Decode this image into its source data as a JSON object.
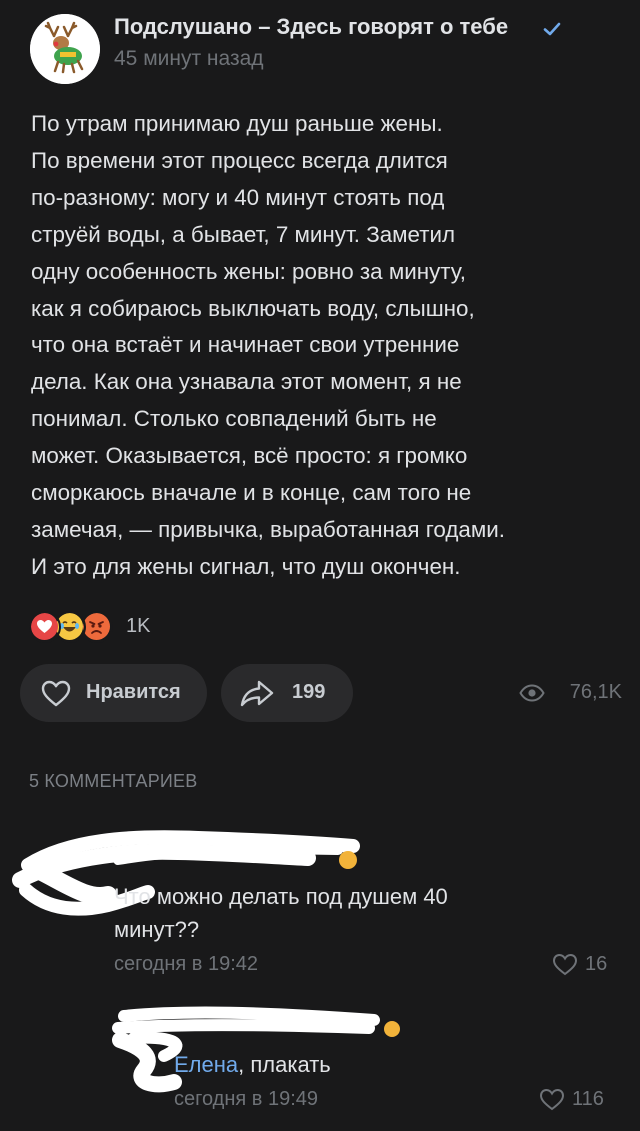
{
  "post": {
    "group_name": "Подслушано – Здесь говорят о тебе",
    "time": "45 минут назад",
    "text_lines": [
      "По утрам принимаю душ раньше жены.",
      "По времени этот процесс всегда длится",
      "по-разному: могу и 40 минут стоять под",
      "струёй воды, а бывает, 7 минут. Заметил",
      "одну особенность жены: ровно за минуту,",
      "как я собираюсь выключать воду, слышно,",
      "что она встаёт и начинает свои утренние",
      "дела. Как она узнавала этот момент, я не",
      "понимал. Столько совпадений быть не",
      "может. Оказывается, всё просто: я громко",
      "сморкаюсь вначале и в конце, сам того не",
      "замечая, — привычка, выработанная годами.",
      "И это для жены сигнал, что душ окончен."
    ],
    "reactions": [
      "heart-reaction",
      "laughing-reaction",
      "angry-reaction"
    ],
    "reactions_count": "1K",
    "like_label": "Нравится",
    "shares_count": "199",
    "views_count": "76,1K"
  },
  "comments_header": "5 КОММЕНТАРИЕВ",
  "comments": [
    {
      "text_lines": [
        "Что можно делать под душем 40",
        "минут??"
      ],
      "time": "сегодня в 19:42",
      "likes": "16"
    },
    {
      "reply_to": "Елена",
      "text": ", плакать",
      "time": "сегодня в 19:49",
      "likes": "116"
    }
  ],
  "colors": {
    "background": "#19191a",
    "text": "#e1e3e6",
    "secondary": "#6f7378",
    "accent": "#71aaeb",
    "button": "#2a2a2c"
  }
}
